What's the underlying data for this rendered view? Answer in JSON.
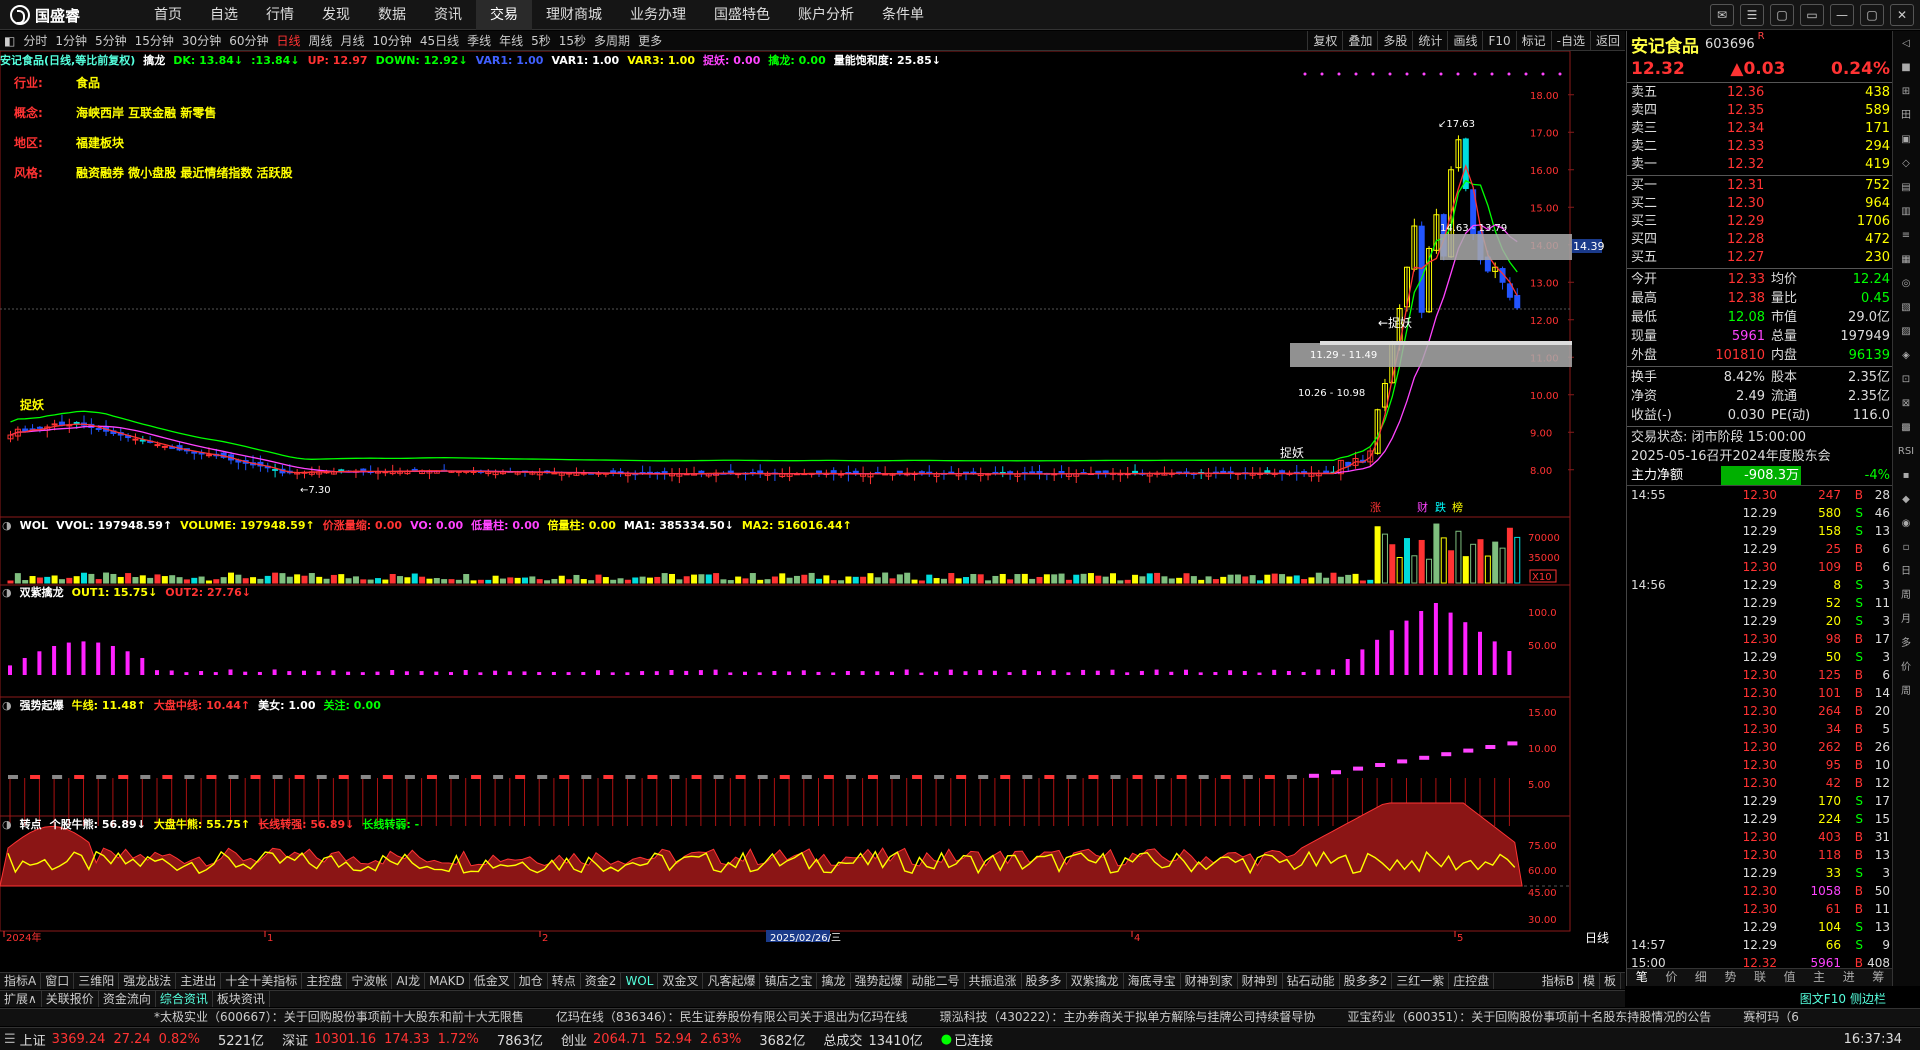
{
  "app": {
    "logo_text": "国盛睿",
    "time": "16:37:34"
  },
  "main_nav": [
    "首页",
    "自选",
    "行情",
    "发现",
    "数据",
    "资讯",
    "交易",
    "理财商城",
    "业务办理",
    "国盛特色",
    "账户分析",
    "条件单"
  ],
  "main_nav_active": 6,
  "periods": [
    "分时",
    "1分钟",
    "5分钟",
    "15分钟",
    "30分钟",
    "60分钟",
    "日线",
    "周线",
    "月线",
    "10分钟",
    "45日线",
    "季线",
    "年线",
    "5秒",
    "15秒",
    "多周期",
    "更多"
  ],
  "period_active": 6,
  "period_tools": [
    "复权",
    "叠加",
    "多股",
    "统计",
    "画线",
    "F10",
    "标记",
    "-自选",
    "返回"
  ],
  "chart_header": {
    "title": "安记食品(日线,等比前复权)",
    "formula": "擒龙",
    "items": [
      {
        "text": "DK: 13.84↓",
        "color": "#00ff00"
      },
      {
        "text": ":13.84↓",
        "color": "#00ff00"
      },
      {
        "text": "UP: 12.97",
        "color": "#ff3333"
      },
      {
        "text": "DOWN: 12.92↓",
        "color": "#00ff00"
      },
      {
        "text": "VAR1: 1.00",
        "color": "#4060ff"
      },
      {
        "text": "VAR1: 1.00",
        "color": "#ffffff"
      },
      {
        "text": "VAR3: 1.00",
        "color": "#ffff00"
      },
      {
        "text": "捉妖: 0.00",
        "color": "#ff44ff"
      },
      {
        "text": "擒龙: 0.00",
        "color": "#00ff00"
      },
      {
        "text": "量能饱和度: 25.85↓",
        "color": "#ffffff"
      }
    ]
  },
  "info": [
    {
      "label": "行业:",
      "value": "食品"
    },
    {
      "label": "概念:",
      "value": "海峡西岸 互联金融 新零售"
    },
    {
      "label": "地区:",
      "value": "福建板块"
    },
    {
      "label": "风格:",
      "value": "融资融券 微小盘股 最近情绪指数 活跃股"
    }
  ],
  "price_axis": [
    "18.00",
    "17.00",
    "16.00",
    "15.00",
    "14.00",
    "13.00",
    "12.00",
    "11.00",
    "10.00",
    "9.00",
    "8.00"
  ],
  "current_price_tag": "14.39",
  "annotations": {
    "high": "17.63",
    "zone1": "14.63 - 13.79",
    "zone2": "11.29 - 11.49",
    "zone3": "10.26 - 10.98",
    "low": "7.30",
    "catch1": "捉妖",
    "catch2": "←捉妖",
    "catch3": "捉妖",
    "markers": [
      "涨",
      "财",
      "跌",
      "榜"
    ]
  },
  "vol_panel": {
    "items": [
      {
        "text": "WOL",
        "color": "#ffffff"
      },
      {
        "text": "VVOL: 197948.59↑",
        "color": "#ffffff"
      },
      {
        "text": "VOLUME: 197948.59↑",
        "color": "#ffff00"
      },
      {
        "text": "价涨量缩: 0.00",
        "color": "#ff3333"
      },
      {
        "text": "VO: 0.00",
        "color": "#ff44ff"
      },
      {
        "text": "低量柱: 0.00",
        "color": "#ff44ff"
      },
      {
        "text": "倍量柱: 0.00",
        "color": "#ffff00"
      },
      {
        "text": "MA1: 385334.50↓",
        "color": "#ffffff"
      },
      {
        "text": "MA2: 516016.44↑",
        "color": "#ffff00"
      }
    ],
    "axis": [
      "70000",
      "35000"
    ],
    "unit": "X10"
  },
  "p2": {
    "items": [
      {
        "text": "双紫擒龙",
        "color": "#ffffff"
      },
      {
        "text": "OUT1: 15.75↓",
        "color": "#ffff00"
      },
      {
        "text": "OUT2: 27.76↓",
        "color": "#ff3333"
      }
    ],
    "axis": [
      "100.0",
      "50.00"
    ]
  },
  "p3": {
    "items": [
      {
        "text": "强势起爆",
        "color": "#ffffff"
      },
      {
        "text": "牛线: 11.48↑",
        "color": "#ffff00"
      },
      {
        "text": "大盘中线: 10.44↑",
        "color": "#ff3333"
      },
      {
        "text": "美女: 1.00",
        "color": "#ffffff"
      },
      {
        "text": "关注: 0.00",
        "color": "#00ff00"
      }
    ],
    "axis": [
      "15.00",
      "10.00",
      "5.00"
    ]
  },
  "p4": {
    "items": [
      {
        "text": "转点",
        "color": "#ffffff"
      },
      {
        "text": "个股牛熊: 56.89↓",
        "color": "#ffffff"
      },
      {
        "text": "大盘牛熊: 55.75↑",
        "color": "#ffff00"
      },
      {
        "text": "长线转强: 56.89↓",
        "color": "#ff3333"
      },
      {
        "text": "长线转弱: -",
        "color": "#00ff00"
      }
    ],
    "axis": [
      "75.00",
      "60.00",
      "45.00",
      "30.00"
    ]
  },
  "date_axis": [
    "2024年",
    "1",
    "2",
    "2025/02/26/三",
    "4",
    "5"
  ],
  "date_axis_label": "日线",
  "bottom_tabs1": [
    "指标A",
    "窗口",
    "三维阳",
    "强龙战法",
    "主进出",
    "十全十美指标",
    "主控盘",
    "宁波帐",
    "AI龙",
    "MAKD",
    "低金叉",
    "加仓",
    "转点",
    "资金2",
    "WOL",
    "双金叉",
    "凡客起爆",
    "镇店之宝",
    "擒龙",
    "强势起爆",
    "动能二号",
    "共振追涨",
    "股多多",
    "双紫擒龙",
    "海底寻宝",
    "财神到家",
    "财神到",
    "钻石动能",
    "股多多2",
    "三红一紫",
    "庄控盘"
  ],
  "bottom_tabs1_right": [
    "指标B",
    "模",
    "板"
  ],
  "bottom_tabs2": [
    "扩展∧",
    "关联报价",
    "资金流向",
    "综合资讯",
    "板块资讯"
  ],
  "right_panel": {
    "name": "安记食品",
    "code": "603696",
    "flag": "R",
    "price": "12.32",
    "change": "▲0.03",
    "pct": "0.24%",
    "asks": [
      {
        "l": "卖五",
        "p": "12.36",
        "v": "438"
      },
      {
        "l": "卖四",
        "p": "12.35",
        "v": "589"
      },
      {
        "l": "卖三",
        "p": "12.34",
        "v": "171"
      },
      {
        "l": "卖二",
        "p": "12.33",
        "v": "294"
      },
      {
        "l": "卖一",
        "p": "12.32",
        "v": "419"
      }
    ],
    "bids": [
      {
        "l": "买一",
        "p": "12.31",
        "v": "752"
      },
      {
        "l": "买二",
        "p": "12.30",
        "v": "964"
      },
      {
        "l": "买三",
        "p": "12.29",
        "v": "1706"
      },
      {
        "l": "买四",
        "p": "12.28",
        "v": "472"
      },
      {
        "l": "买五",
        "p": "12.27",
        "v": "230"
      }
    ],
    "quote": [
      {
        "k": "今开",
        "v": "12.33",
        "k2": "均价",
        "v2": "12.24",
        "c": "#ff3333",
        "c2": "#00ff00"
      },
      {
        "k": "最高",
        "v": "12.38",
        "k2": "量比",
        "v2": "0.45",
        "c": "#ff3333",
        "c2": "#00ff00"
      },
      {
        "k": "最低",
        "v": "12.08",
        "k2": "市值",
        "v2": "29.0亿",
        "c": "#00ff00",
        "c2": "#ddd"
      },
      {
        "k": "现量",
        "v": "5961",
        "k2": "总量",
        "v2": "197949",
        "c": "#ff44ff",
        "c2": "#ddd"
      },
      {
        "k": "外盘",
        "v": "101810",
        "k2": "内盘",
        "v2": "96139",
        "c": "#ff3333",
        "c2": "#00ff00"
      }
    ],
    "quote2": [
      {
        "k": "换手",
        "v": "8.42%",
        "k2": "股本",
        "v2": "2.35亿"
      },
      {
        "k": "净资",
        "v": "2.49",
        "k2": "流通",
        "v2": "2.35亿"
      },
      {
        "k": "收益(-)",
        "v": "0.030",
        "k2": "PE(动)",
        "v2": "116.0"
      }
    ],
    "status": "交易状态: 闭市阶段 15:00:00",
    "event": "2025-05-16召开2024年度股东会",
    "netflow_label": "主力净额",
    "netflow": "-908.3万",
    "netflow_pct": "-4%",
    "ticks": [
      {
        "t": "14:55",
        "p": "12.30",
        "v": "247",
        "s": "B",
        "n": "28"
      },
      {
        "t": "",
        "p": "12.29",
        "v": "580",
        "s": "S",
        "n": "46"
      },
      {
        "t": "",
        "p": "12.29",
        "v": "158",
        "s": "S",
        "n": "13"
      },
      {
        "t": "",
        "p": "12.29",
        "v": "25",
        "s": "B",
        "n": "6"
      },
      {
        "t": "",
        "p": "12.30",
        "v": "109",
        "s": "B",
        "n": "6"
      },
      {
        "t": "14:56",
        "p": "12.29",
        "v": "8",
        "s": "S",
        "n": "3"
      },
      {
        "t": "",
        "p": "12.29",
        "v": "52",
        "s": "S",
        "n": "11"
      },
      {
        "t": "",
        "p": "12.29",
        "v": "20",
        "s": "S",
        "n": "3"
      },
      {
        "t": "",
        "p": "12.30",
        "v": "98",
        "s": "B",
        "n": "17"
      },
      {
        "t": "",
        "p": "12.29",
        "v": "50",
        "s": "S",
        "n": "3"
      },
      {
        "t": "",
        "p": "12.30",
        "v": "125",
        "s": "B",
        "n": "6"
      },
      {
        "t": "",
        "p": "12.30",
        "v": "101",
        "s": "B",
        "n": "14"
      },
      {
        "t": "",
        "p": "12.30",
        "v": "264",
        "s": "B",
        "n": "20"
      },
      {
        "t": "",
        "p": "12.30",
        "v": "34",
        "s": "B",
        "n": "5"
      },
      {
        "t": "",
        "p": "12.30",
        "v": "262",
        "s": "B",
        "n": "26"
      },
      {
        "t": "",
        "p": "12.30",
        "v": "95",
        "s": "B",
        "n": "10"
      },
      {
        "t": "",
        "p": "12.30",
        "v": "42",
        "s": "B",
        "n": "12"
      },
      {
        "t": "",
        "p": "12.29",
        "v": "170",
        "s": "S",
        "n": "17"
      },
      {
        "t": "",
        "p": "12.29",
        "v": "224",
        "s": "S",
        "n": "15"
      },
      {
        "t": "",
        "p": "12.30",
        "v": "403",
        "s": "B",
        "n": "31"
      },
      {
        "t": "",
        "p": "12.30",
        "v": "118",
        "s": "B",
        "n": "13"
      },
      {
        "t": "",
        "p": "12.29",
        "v": "33",
        "s": "S",
        "n": "3"
      },
      {
        "t": "",
        "p": "12.30",
        "v": "1058",
        "s": "B",
        "n": "50"
      },
      {
        "t": "",
        "p": "12.30",
        "v": "61",
        "s": "B",
        "n": "11"
      },
      {
        "t": "",
        "p": "12.29",
        "v": "104",
        "s": "S",
        "n": "13"
      },
      {
        "t": "14:57",
        "p": "12.29",
        "v": "66",
        "s": "S",
        "n": "9"
      },
      {
        "t": "15:00",
        "p": "12.32",
        "v": "5961",
        "s": "B",
        "n": "408"
      }
    ],
    "tabs": [
      "笔",
      "价",
      "细",
      "势",
      "联",
      "值",
      "主",
      "进",
      "筹"
    ]
  },
  "sidebar": [
    "◁",
    "■",
    "⊞",
    "田",
    "▣",
    "◇",
    "▤",
    "▥",
    "≡",
    "▦",
    "◎",
    "▧",
    "▨",
    "◈",
    "⊡",
    "⊠",
    "▩",
    "RSI",
    "▪",
    "◆",
    "◉",
    "▫",
    "日",
    "周",
    "月",
    "多",
    "价",
    "周"
  ],
  "news": [
    "*太极实业（600667）：关于回购股份事项前十大股东和前十大无限售",
    "亿玛在线（836346）：民生证券股份有限公司关于退出为亿玛在线",
    "璟泓科技（430222）：主办券商关于拟单方解除与挂牌公司持续督导协",
    "亚宝药业（600351）：关于回购股份事项前十名股东持股情况的公告",
    "赛柯玛（6"
  ],
  "right_tabs": [
    "图文F10",
    "侧边栏"
  ],
  "indices": [
    {
      "name": "上证",
      "v": "3369.24",
      "c": "27.24",
      "p": "0.82%",
      "a": "5221亿"
    },
    {
      "name": "深证",
      "v": "10301.16",
      "c": "174.33",
      "p": "1.72%",
      "a": "7863亿"
    },
    {
      "name": "创业",
      "v": "2064.71",
      "c": "52.94",
      "p": "2.63%",
      "a": "3682亿"
    }
  ],
  "total": {
    "label": "总成交",
    "value": "13410亿"
  },
  "connected": "已连接"
}
